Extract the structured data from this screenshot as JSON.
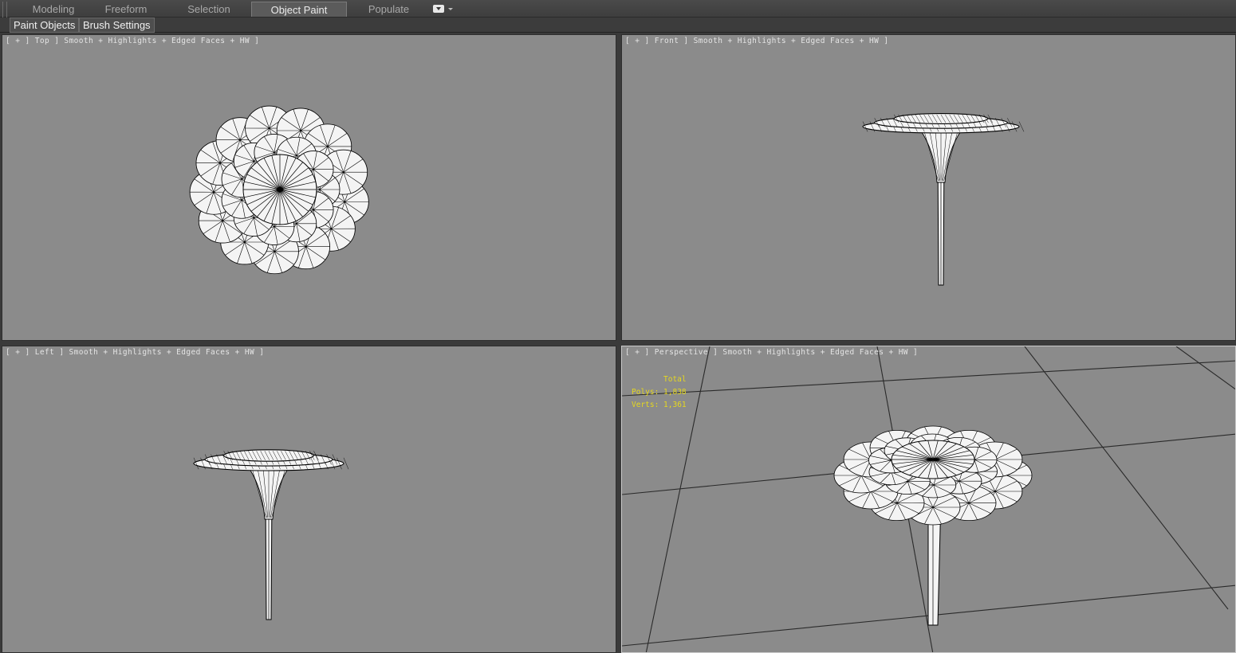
{
  "ribbon": {
    "tabs": [
      {
        "label": "Modeling",
        "active": false
      },
      {
        "label": "Freeform",
        "active": false
      },
      {
        "label": "Selection",
        "active": false
      },
      {
        "label": "Object Paint",
        "active": true
      },
      {
        "label": "Populate",
        "active": false
      }
    ],
    "menu_icon": "dropdown-icon"
  },
  "panels": {
    "paint_objects": "Paint Objects",
    "brush_settings": "Brush Settings"
  },
  "viewports": {
    "top": {
      "label": "[ + ] Top ] Smooth + Highlights + Edged Faces + HW ]"
    },
    "front": {
      "label": "[ + ] Front ] Smooth + Highlights + Edged Faces + HW ]"
    },
    "left": {
      "label": "[ + ] Left ] Smooth + Highlights + Edged Faces + HW ]"
    },
    "perspective": {
      "label": "[ + ] Perspective ] Smooth + Highlights + Edged Faces + HW ]",
      "stats": {
        "total_label": "Total",
        "polys": "Polys: 1,838",
        "verts": "Verts: 1,361"
      }
    }
  },
  "colors": {
    "viewport_bg": "#8b8b8b",
    "ui_dark": "#3a3a3a",
    "stats_text": "#e6d81e",
    "mesh_fill": "#f4f4f4",
    "mesh_edge": "#000000"
  }
}
